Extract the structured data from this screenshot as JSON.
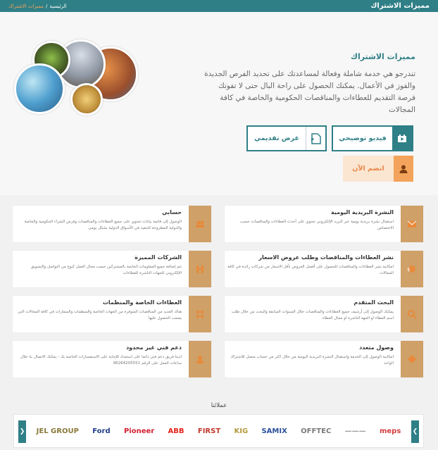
{
  "topbar": {
    "title": "مميزات الاشتراك",
    "breadcrumb": {
      "home": "الرئيسية",
      "separator": "/",
      "current": "مميزات الاشتراك"
    }
  },
  "hero": {
    "title": "مميزات الاشتراك",
    "text": "تندرجو هي خدمة شاملة وفعالة لمساعدتك على تحديد الفرص الجديدة والفوز في الأعمال. يمكنك الحصول على راحة البال حتى لا تفوتك فرصة التقديم للعطاءات والمناقصات الحكومية والخاصة في كافة المجالات"
  },
  "buttons": {
    "video": "فيديو توضيحي",
    "presentation": "عرض تقديمي",
    "join": "انضم الآن"
  },
  "features": [
    {
      "title": "النشرة البريدية اليومية",
      "desc": "استقبال نشرة بريدية يومية عبر البريد الإلكتروني تحتوي على أحدث العطاءات والمناقصات حسب الاختصاص",
      "icon": "newsletter-icon"
    },
    {
      "title": "حسابي",
      "desc": "الوصول إلى قائمة بيانات تحتوي على جميع العطاءات والمناقصات وفرص الشراء الحكومية والخاصة والدولية المطروحة للتنفيذ في الأسواق الدولية بشكل يومي",
      "icon": "account-icon"
    },
    {
      "title": "نشر العطاءات والمناقصات وطلب عروض الاسعار",
      "desc": "امكانية نشر العطاءات والمناقصات للحصول على أفضل العروض بأقل الاسعار من شركات رائدة في كافة المجالات",
      "icon": "publish-icon"
    },
    {
      "title": "الشركات المميزة",
      "desc": "تتم إضافة جميع المعلومات الخاصة بالمشتركين حسب مجال العمل كنوع من التواصل والتسويق الإلكتروني للجهات الناشرة للعطاءات",
      "icon": "companies-icon"
    },
    {
      "title": "البحث المتقدم",
      "desc": "يمكنك الوصول إلى أرشيف جميع العطاءات والمناقصات خلال السنوات السابقة والبحث من خلال طلب اسم العطاء او الجهة الناشرة او مجال العطاء",
      "icon": "search-icon"
    },
    {
      "title": "العطاءات الخاصة والمنظمات",
      "desc": "هناك العديد من المناقصات المتوفرة من الجهات الخاصة والمنظمات والسفارات في كافة المجالات التي يصعب الحصول عليها",
      "icon": "organizations-icon"
    },
    {
      "title": "وصول متعدد",
      "desc": "امكانية الوصول إلى الخدمة واستقبال النشرة البريدية اليومية من خلال اكثر من حساب متصل للاشتراك الواحد",
      "icon": "multi-access-icon"
    },
    {
      "title": "دعم فني غير محدود",
      "desc": "لدينا فريق دعم فني دائما على استعداد للإجابة على الاستفسارات الخاصة بك - يمكنك الاتصال بنا خلال ساعات العمل على الرقم 96264205551",
      "icon": "support-icon"
    }
  ],
  "clients": {
    "title": "عملائنا",
    "logos": [
      {
        "name": "meps",
        "color": "#d23c3c"
      },
      {
        "name": "———",
        "color": "#999999"
      },
      {
        "name": "OFFTEC",
        "color": "#7a7a7a"
      },
      {
        "name": "SAMIX",
        "color": "#2a4f9a"
      },
      {
        "name": "KIG",
        "color": "#b59a3c"
      },
      {
        "name": "FIRST",
        "color": "#c0392b"
      },
      {
        "name": "ABB",
        "color": "#e2231a"
      },
      {
        "name": "Pioneer",
        "color": "#d22030"
      },
      {
        "name": "Ford",
        "color": "#1f3d8a"
      },
      {
        "name": "JEL GROUP",
        "color": "#8a7a3a"
      }
    ]
  },
  "colors": {
    "primary": "#2f7f86",
    "accent": "#f3a35b",
    "card_icon": "#cfa068"
  }
}
